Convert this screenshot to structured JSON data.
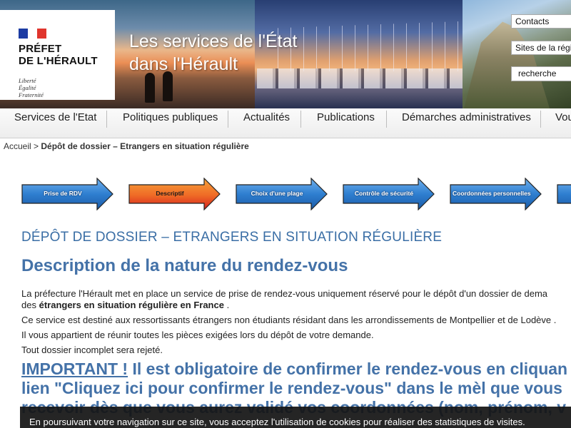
{
  "header": {
    "logo_title_line1": "PRÉFET",
    "logo_title_line2": "DE L'HÉRAULT",
    "logo_motto_1": "Liberté",
    "logo_motto_2": "Égalité",
    "logo_motto_3": "Fraternité",
    "site_title": "Les services de l'État dans l'Hérault",
    "links": [
      "Contacts",
      "Sites de la régi"
    ],
    "search_placeholder": "recherche",
    "colors": {
      "flag_blue": "#1c3ba3",
      "flag_red": "#e0352d"
    }
  },
  "nav": {
    "items": [
      "Services de l'Etat",
      "Politiques publiques",
      "Actualités",
      "Publications",
      "Démarches administratives",
      "Vou"
    ]
  },
  "breadcrumb": {
    "home": "Accueil",
    "separator": ">",
    "current": "Dépôt de dossier – Etrangers en situation régulière"
  },
  "steps": {
    "items": [
      {
        "label": "Prise de RDV",
        "state": "done"
      },
      {
        "label": "Descriptif",
        "state": "active"
      },
      {
        "label": "Choix d'une plage",
        "state": "todo"
      },
      {
        "label": "Contrôle de sécurité",
        "state": "todo"
      },
      {
        "label": "Coordonnées personnelles",
        "state": "todo"
      },
      {
        "label": "",
        "state": "todo"
      }
    ],
    "colors": {
      "blue": "#2f7fd0",
      "active_top": "#f7a23a",
      "active_bottom": "#d4201d"
    }
  },
  "main": {
    "page_title": "DÉPÔT DE DOSSIER – ETRANGERS EN SITUATION RÉGULIÈRE",
    "section_title": "Description de la nature du rendez-vous",
    "p1_text": "La préfecture l'Hérault met en place un service de prise de rendez-vous uniquement réservé pour le dépôt d'un dossier de dema",
    "p1_line2_prefix": "des",
    "p1_line2_bold": "étrangers en situation régulière en France",
    "p1_line2_suffix": ".",
    "p2": "Ce service est destiné aux ressortissants étrangers non étudiants résidant dans les arrondissements de Montpellier et de Lodève .",
    "p3": "Il vous appartient de réunir toutes les pièces exigées lors du dépôt de votre demande.",
    "p4": "Tout dossier incomplet sera rejeté.",
    "important_label": "IMPORTANT !",
    "important_text1": " Il est obligatoire de confirmer le rendez-vous en cliquan",
    "important_text2": "lien \"Cliquez ici pour confirmer le rendez-vous\" dans le mèl que vous",
    "important_text3": "recevoir dès que vous aurez validé vos coordonnées (nom, prénom, v"
  },
  "cookie_banner": {
    "text": "En poursuivant votre navigation sur ce site, vous acceptez l'utilisation de cookies pour réaliser des statistiques de visites."
  }
}
